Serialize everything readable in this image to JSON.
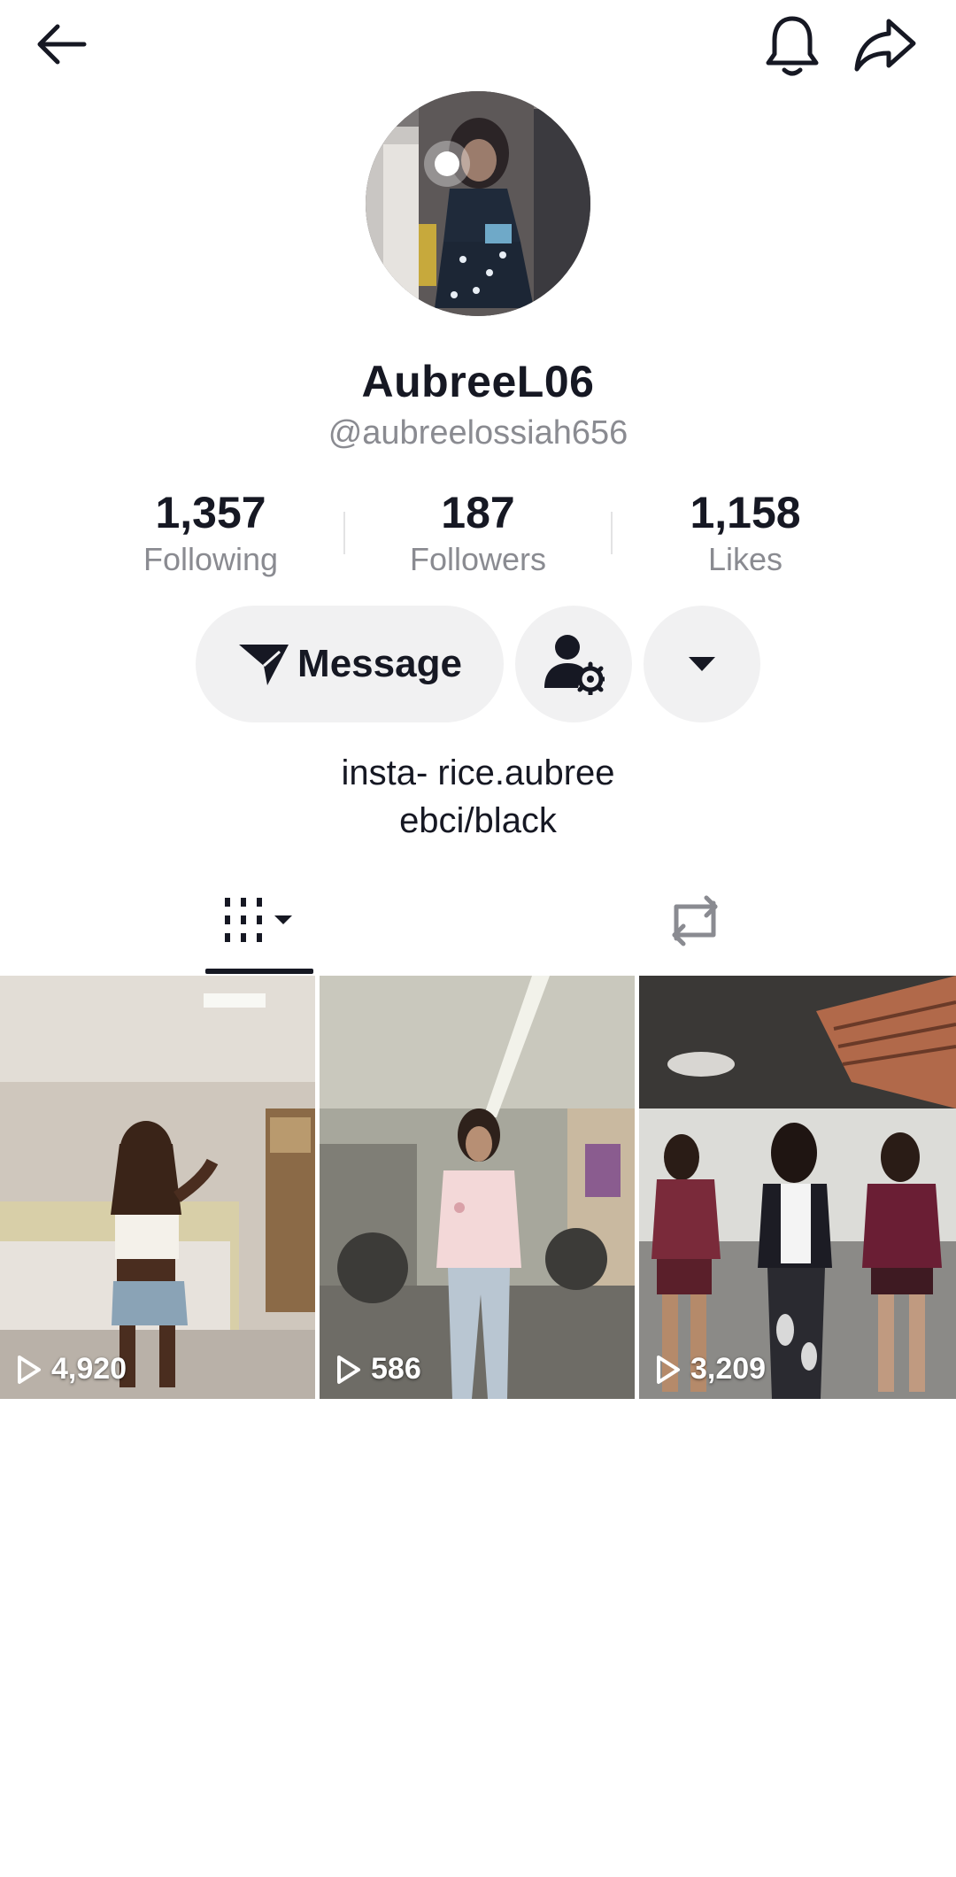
{
  "header": {
    "back_icon": "arrow-left-icon",
    "bell_icon": "bell-icon",
    "share_icon": "share-arrow-icon"
  },
  "profile": {
    "display_name": "AubreeL06",
    "username": "@aubreelossiah656",
    "avatar_icon": "profile-photo"
  },
  "stats": {
    "following": {
      "value": "1,357",
      "label": "Following"
    },
    "followers": {
      "value": "187",
      "label": "Followers"
    },
    "likes": {
      "value": "1,158",
      "label": "Likes"
    }
  },
  "actions": {
    "message_label": "Message",
    "message_icon": "paper-plane-icon",
    "friends_icon": "person-gear-icon",
    "more_icon": "caret-down-icon"
  },
  "bio": {
    "line1": "insta- rice.aubree",
    "line2": "ebci/black"
  },
  "tabs": {
    "videos_icon": "grid-bars-icon",
    "reposts_icon": "repost-icon"
  },
  "videos": [
    {
      "views": "4,920"
    },
    {
      "views": "586"
    },
    {
      "views": "3,209"
    }
  ],
  "colors": {
    "text": "#161823",
    "muted": "#8a8b91",
    "button_bg": "#f1f1f2"
  }
}
